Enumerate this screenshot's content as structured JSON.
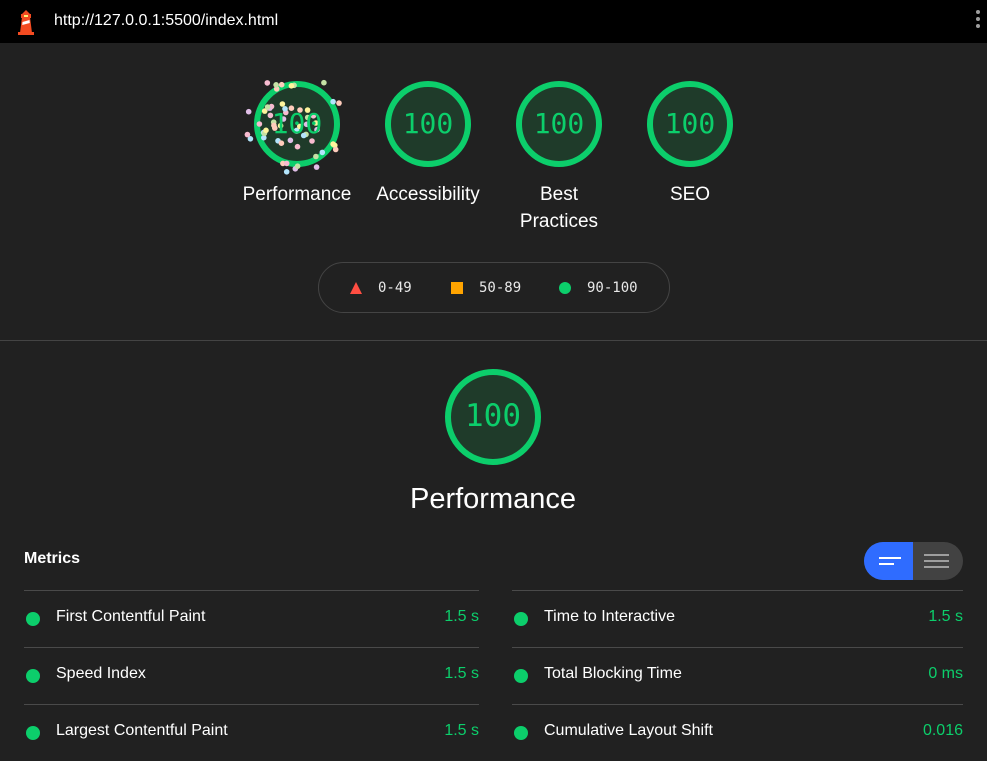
{
  "topbar": {
    "url": "http://127.0.0.1:5500/index.html",
    "logo_icon": "lighthouse-icon",
    "menu_icon": "kebab-menu-icon"
  },
  "colors": {
    "pass": "#0cce6b",
    "average": "#ffa400",
    "fail": "#ff4e42",
    "toggle_active": "#2f6cff"
  },
  "categories": [
    {
      "label": "Performance",
      "score": "100"
    },
    {
      "label": "Accessibility",
      "score": "100"
    },
    {
      "label": "Best Practices",
      "score": "100"
    },
    {
      "label": "SEO",
      "score": "100"
    }
  ],
  "legend": [
    {
      "shape": "triangle",
      "range": "0-49"
    },
    {
      "shape": "square",
      "range": "50-89"
    },
    {
      "shape": "circle",
      "range": "90-100"
    }
  ],
  "performance": {
    "title": "Performance",
    "score": "100"
  },
  "metrics": {
    "title": "Metrics",
    "items": [
      {
        "name": "First Contentful Paint",
        "value": "1.5 s"
      },
      {
        "name": "Time to Interactive",
        "value": "1.5 s"
      },
      {
        "name": "Speed Index",
        "value": "1.5 s"
      },
      {
        "name": "Total Blocking Time",
        "value": "0 ms"
      },
      {
        "name": "Largest Contentful Paint",
        "value": "1.5 s"
      },
      {
        "name": "Cumulative Layout Shift",
        "value": "0.016"
      }
    ]
  }
}
